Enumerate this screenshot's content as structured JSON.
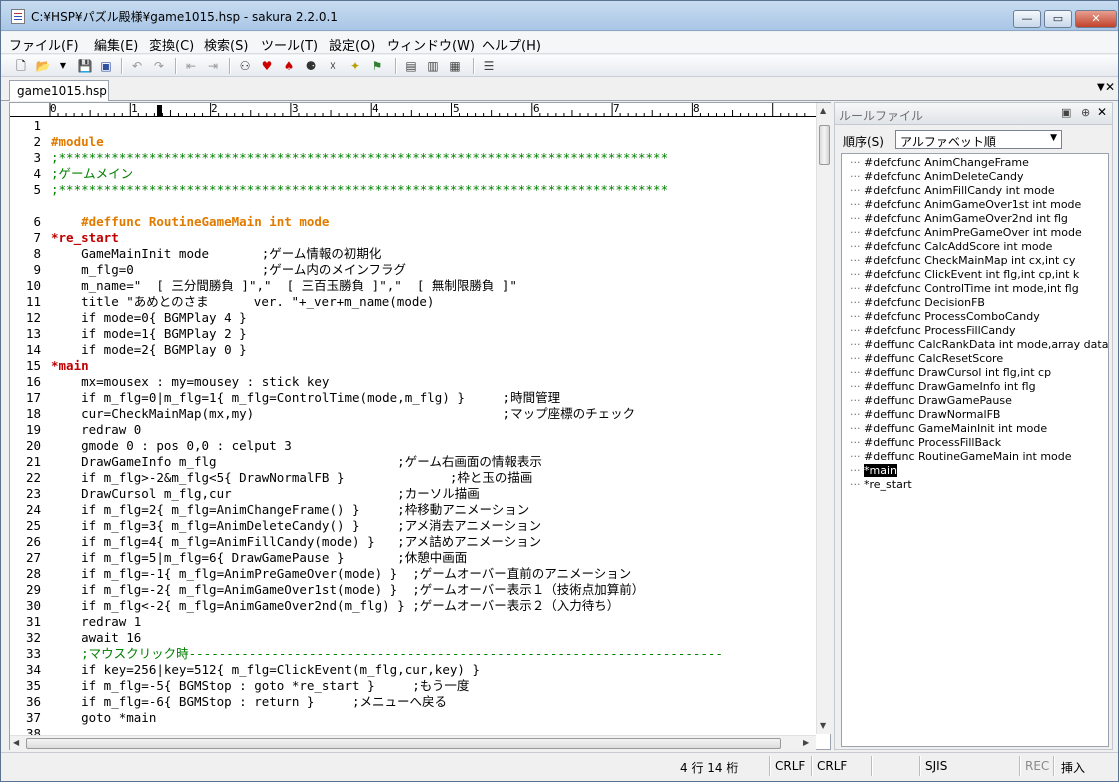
{
  "window": {
    "title": "C:¥HSP¥パズル殿様¥game1015.hsp - sakura 2.2.0.1"
  },
  "menu": [
    {
      "label": "ファイル(F)"
    },
    {
      "label": "編集(E)"
    },
    {
      "label": "変換(C)"
    },
    {
      "label": "検索(S)"
    },
    {
      "label": "ツール(T)"
    },
    {
      "label": "設定(O)"
    },
    {
      "label": "ウィンドウ(W)"
    },
    {
      "label": "ヘルプ(H)"
    }
  ],
  "toolbar": {
    "icons": [
      "new-file-icon",
      "open-file-icon",
      "dropdown-arrow-icon",
      "save-icon",
      "save-all-icon",
      "undo-icon",
      "redo-icon",
      "back-icon",
      "forward-icon",
      "search-icon",
      "search-next-icon",
      "search-prev-icon",
      "replace-icon",
      "mark-icon",
      "grep-icon",
      "jump-icon",
      "compare-icon",
      "outline-icon",
      "macro-icon",
      "settings-icon"
    ]
  },
  "tabs": [
    {
      "label": "game1015.hsp"
    }
  ],
  "ruler": {
    "labels": [
      "0",
      "1",
      "2",
      "3",
      "4",
      "5",
      "6",
      "7",
      "8"
    ]
  },
  "editor": {
    "lines": [
      {
        "n": "1",
        "text": "",
        "style": ""
      },
      {
        "n": "2",
        "text": "#module",
        "style": "kw"
      },
      {
        "n": "3",
        "text": ";*********************************************************************************",
        "style": "comment"
      },
      {
        "n": "4",
        "text": ";ゲームメイン",
        "style": "comment"
      },
      {
        "n": "5",
        "text": ";*********************************************************************************",
        "style": "comment"
      },
      {
        "n": "",
        "text": "",
        "style": ""
      },
      {
        "n": "6",
        "text": "    #deffunc RoutineGameMain int mode",
        "style": "kw"
      },
      {
        "n": "7",
        "text": "*re_start",
        "style": "label"
      },
      {
        "n": "8",
        "text": "    GameMainInit mode       ;ゲーム情報の初期化",
        "style": ""
      },
      {
        "n": "9",
        "text": "    m_flg=0                 ;ゲーム内のメインフラグ",
        "style": ""
      },
      {
        "n": "10",
        "text": "    m_name=\"  [ 三分間勝負 ]\",\"  [ 三百玉勝負 ]\",\"  [ 無制限勝負 ]\"",
        "style": ""
      },
      {
        "n": "11",
        "text": "    title \"あめとのさま      ver. \"+_ver+m_name(mode)",
        "style": ""
      },
      {
        "n": "12",
        "text": "    if mode=0{ BGMPlay 4 }",
        "style": ""
      },
      {
        "n": "13",
        "text": "    if mode=1{ BGMPlay 2 }",
        "style": ""
      },
      {
        "n": "14",
        "text": "    if mode=2{ BGMPlay 0 }",
        "style": ""
      },
      {
        "n": "15",
        "text": "*main",
        "style": "label"
      },
      {
        "n": "16",
        "text": "    mx=mousex : my=mousey : stick key",
        "style": ""
      },
      {
        "n": "17",
        "text": "    if m_flg=0|m_flg=1{ m_flg=ControlTime(mode,m_flg) }     ;時間管理",
        "style": ""
      },
      {
        "n": "18",
        "text": "    cur=CheckMainMap(mx,my)                                 ;マップ座標のチェック",
        "style": ""
      },
      {
        "n": "19",
        "text": "    redraw 0",
        "style": ""
      },
      {
        "n": "20",
        "text": "    gmode 0 : pos 0,0 : celput 3",
        "style": ""
      },
      {
        "n": "21",
        "text": "    DrawGameInfo m_flg                        ;ゲーム右画面の情報表示",
        "style": ""
      },
      {
        "n": "22",
        "text": "    if m_flg>-2&m_flg<5{ DrawNormalFB }              ;枠と玉の描画",
        "style": ""
      },
      {
        "n": "23",
        "text": "    DrawCursol m_flg,cur                      ;カーソル描画",
        "style": ""
      },
      {
        "n": "24",
        "text": "    if m_flg=2{ m_flg=AnimChangeFrame() }     ;枠移動アニメーション",
        "style": ""
      },
      {
        "n": "25",
        "text": "    if m_flg=3{ m_flg=AnimDeleteCandy() }     ;アメ消去アニメーション",
        "style": ""
      },
      {
        "n": "26",
        "text": "    if m_flg=4{ m_flg=AnimFillCandy(mode) }   ;アメ詰めアニメーション",
        "style": ""
      },
      {
        "n": "27",
        "text": "    if m_flg=5|m_flg=6{ DrawGamePause }       ;休憩中画面",
        "style": ""
      },
      {
        "n": "28",
        "text": "    if m_flg=-1{ m_flg=AnimPreGameOver(mode) }  ;ゲームオーバー直前のアニメーション",
        "style": ""
      },
      {
        "n": "29",
        "text": "    if m_flg=-2{ m_flg=AnimGameOver1st(mode) }  ;ゲームオーバー表示１（技術点加算前）",
        "style": ""
      },
      {
        "n": "30",
        "text": "    if m_flg<-2{ m_flg=AnimGameOver2nd(m_flg) } ;ゲームオーバー表示２（入力待ち）",
        "style": ""
      },
      {
        "n": "31",
        "text": "    redraw 1",
        "style": ""
      },
      {
        "n": "32",
        "text": "    await 16",
        "style": ""
      },
      {
        "n": "33",
        "text": "    ;マウスクリック時-----------------------------------------------------------------------",
        "style": "comment"
      },
      {
        "n": "34",
        "text": "    if key=256|key=512{ m_flg=ClickEvent(m_flg,cur,key) }",
        "style": ""
      },
      {
        "n": "35",
        "text": "    if m_flg=-5{ BGMStop : goto *re_start }     ;もう一度",
        "style": ""
      },
      {
        "n": "36",
        "text": "    if m_flg=-6{ BGMStop : return }     ;メニューへ戻る",
        "style": ""
      },
      {
        "n": "37",
        "text": "    goto *main",
        "style": ""
      },
      {
        "n": "38",
        "text": "",
        "style": ""
      }
    ]
  },
  "rulepane": {
    "title": "ルールファイル",
    "sort_label": "順序(S)",
    "sort_value": "アルファベット順",
    "items": [
      {
        "label": "#defcfunc AnimChangeFrame",
        "selected": false
      },
      {
        "label": "#defcfunc AnimDeleteCandy",
        "selected": false
      },
      {
        "label": "#defcfunc AnimFillCandy int mode",
        "selected": false
      },
      {
        "label": "#defcfunc AnimGameOver1st int mode",
        "selected": false
      },
      {
        "label": "#defcfunc AnimGameOver2nd int flg",
        "selected": false
      },
      {
        "label": "#defcfunc AnimPreGameOver int mode",
        "selected": false
      },
      {
        "label": "#defcfunc CalcAddScore int mode",
        "selected": false
      },
      {
        "label": "#defcfunc CheckMainMap int cx,int cy",
        "selected": false
      },
      {
        "label": "#defcfunc ClickEvent int flg,int cp,int k",
        "selected": false
      },
      {
        "label": "#defcfunc ControlTime int mode,int flg",
        "selected": false
      },
      {
        "label": "#defcfunc DecisionFB",
        "selected": false
      },
      {
        "label": "#defcfunc ProcessComboCandy",
        "selected": false
      },
      {
        "label": "#defcfunc ProcessFillCandy",
        "selected": false
      },
      {
        "label": "#deffunc CalcRankData int mode,array data",
        "selected": false
      },
      {
        "label": "#deffunc CalcResetScore",
        "selected": false
      },
      {
        "label": "#deffunc DrawCursol int flg,int cp",
        "selected": false
      },
      {
        "label": "#deffunc DrawGameInfo int flg",
        "selected": false
      },
      {
        "label": "#deffunc DrawGamePause",
        "selected": false
      },
      {
        "label": "#deffunc DrawNormalFB",
        "selected": false
      },
      {
        "label": "#deffunc GameMainInit int mode",
        "selected": false
      },
      {
        "label": "#deffunc ProcessFillBack",
        "selected": false
      },
      {
        "label": "#deffunc RoutineGameMain int mode",
        "selected": false
      },
      {
        "label": "*main",
        "selected": true
      },
      {
        "label": "*re_start",
        "selected": false
      }
    ]
  },
  "status": {
    "position": "4 行   14 桁",
    "eol1": "CRLF",
    "eol2": "CRLF",
    "blank": "",
    "charset": "SJIS",
    "rec": "REC",
    "mode": "挿入"
  }
}
